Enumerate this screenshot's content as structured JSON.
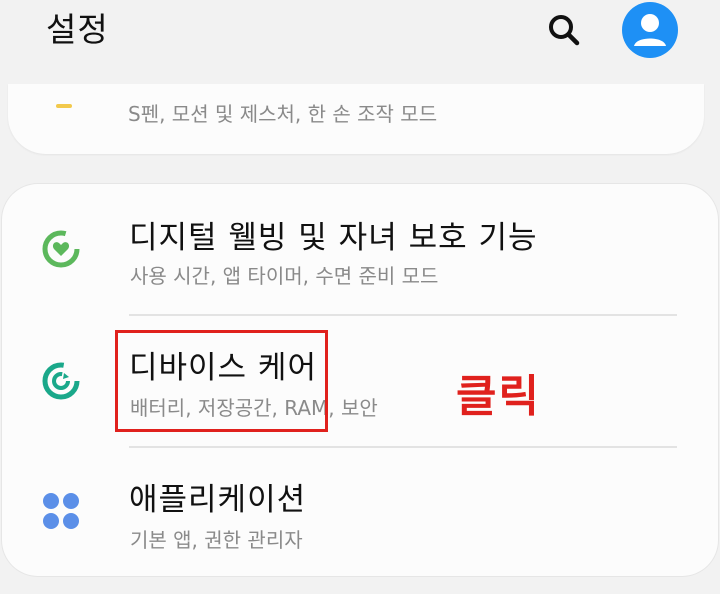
{
  "header": {
    "title": "설정",
    "search_icon": "search-icon",
    "profile_icon": "account-circle-icon"
  },
  "top_card": {
    "subtitle": "S펜, 모션 및 제스처, 한 손 조작 모드"
  },
  "items": [
    {
      "label": "디지털 웰빙 및 자녀 보호 기능",
      "description": "사용 시간, 앱 타이머, 수면 준비 모드",
      "icon": "digital-wellbeing-icon",
      "color": "#5cb85c"
    },
    {
      "label": "디바이스 케어",
      "description": "배터리, 저장공간, RAM, 보안",
      "icon": "device-care-icon",
      "color": "#1aa88a"
    },
    {
      "label": "애플리케이션",
      "description": "기본 앱, 권한 관리자",
      "icon": "apps-grid-icon",
      "color": "#5b8fe8"
    }
  ],
  "annotation": {
    "text": "클릭",
    "color": "#e0211d"
  },
  "colors": {
    "accent_blue": "#1e90f5",
    "background": "#f2f2f2",
    "card": "#fcfcfc"
  }
}
